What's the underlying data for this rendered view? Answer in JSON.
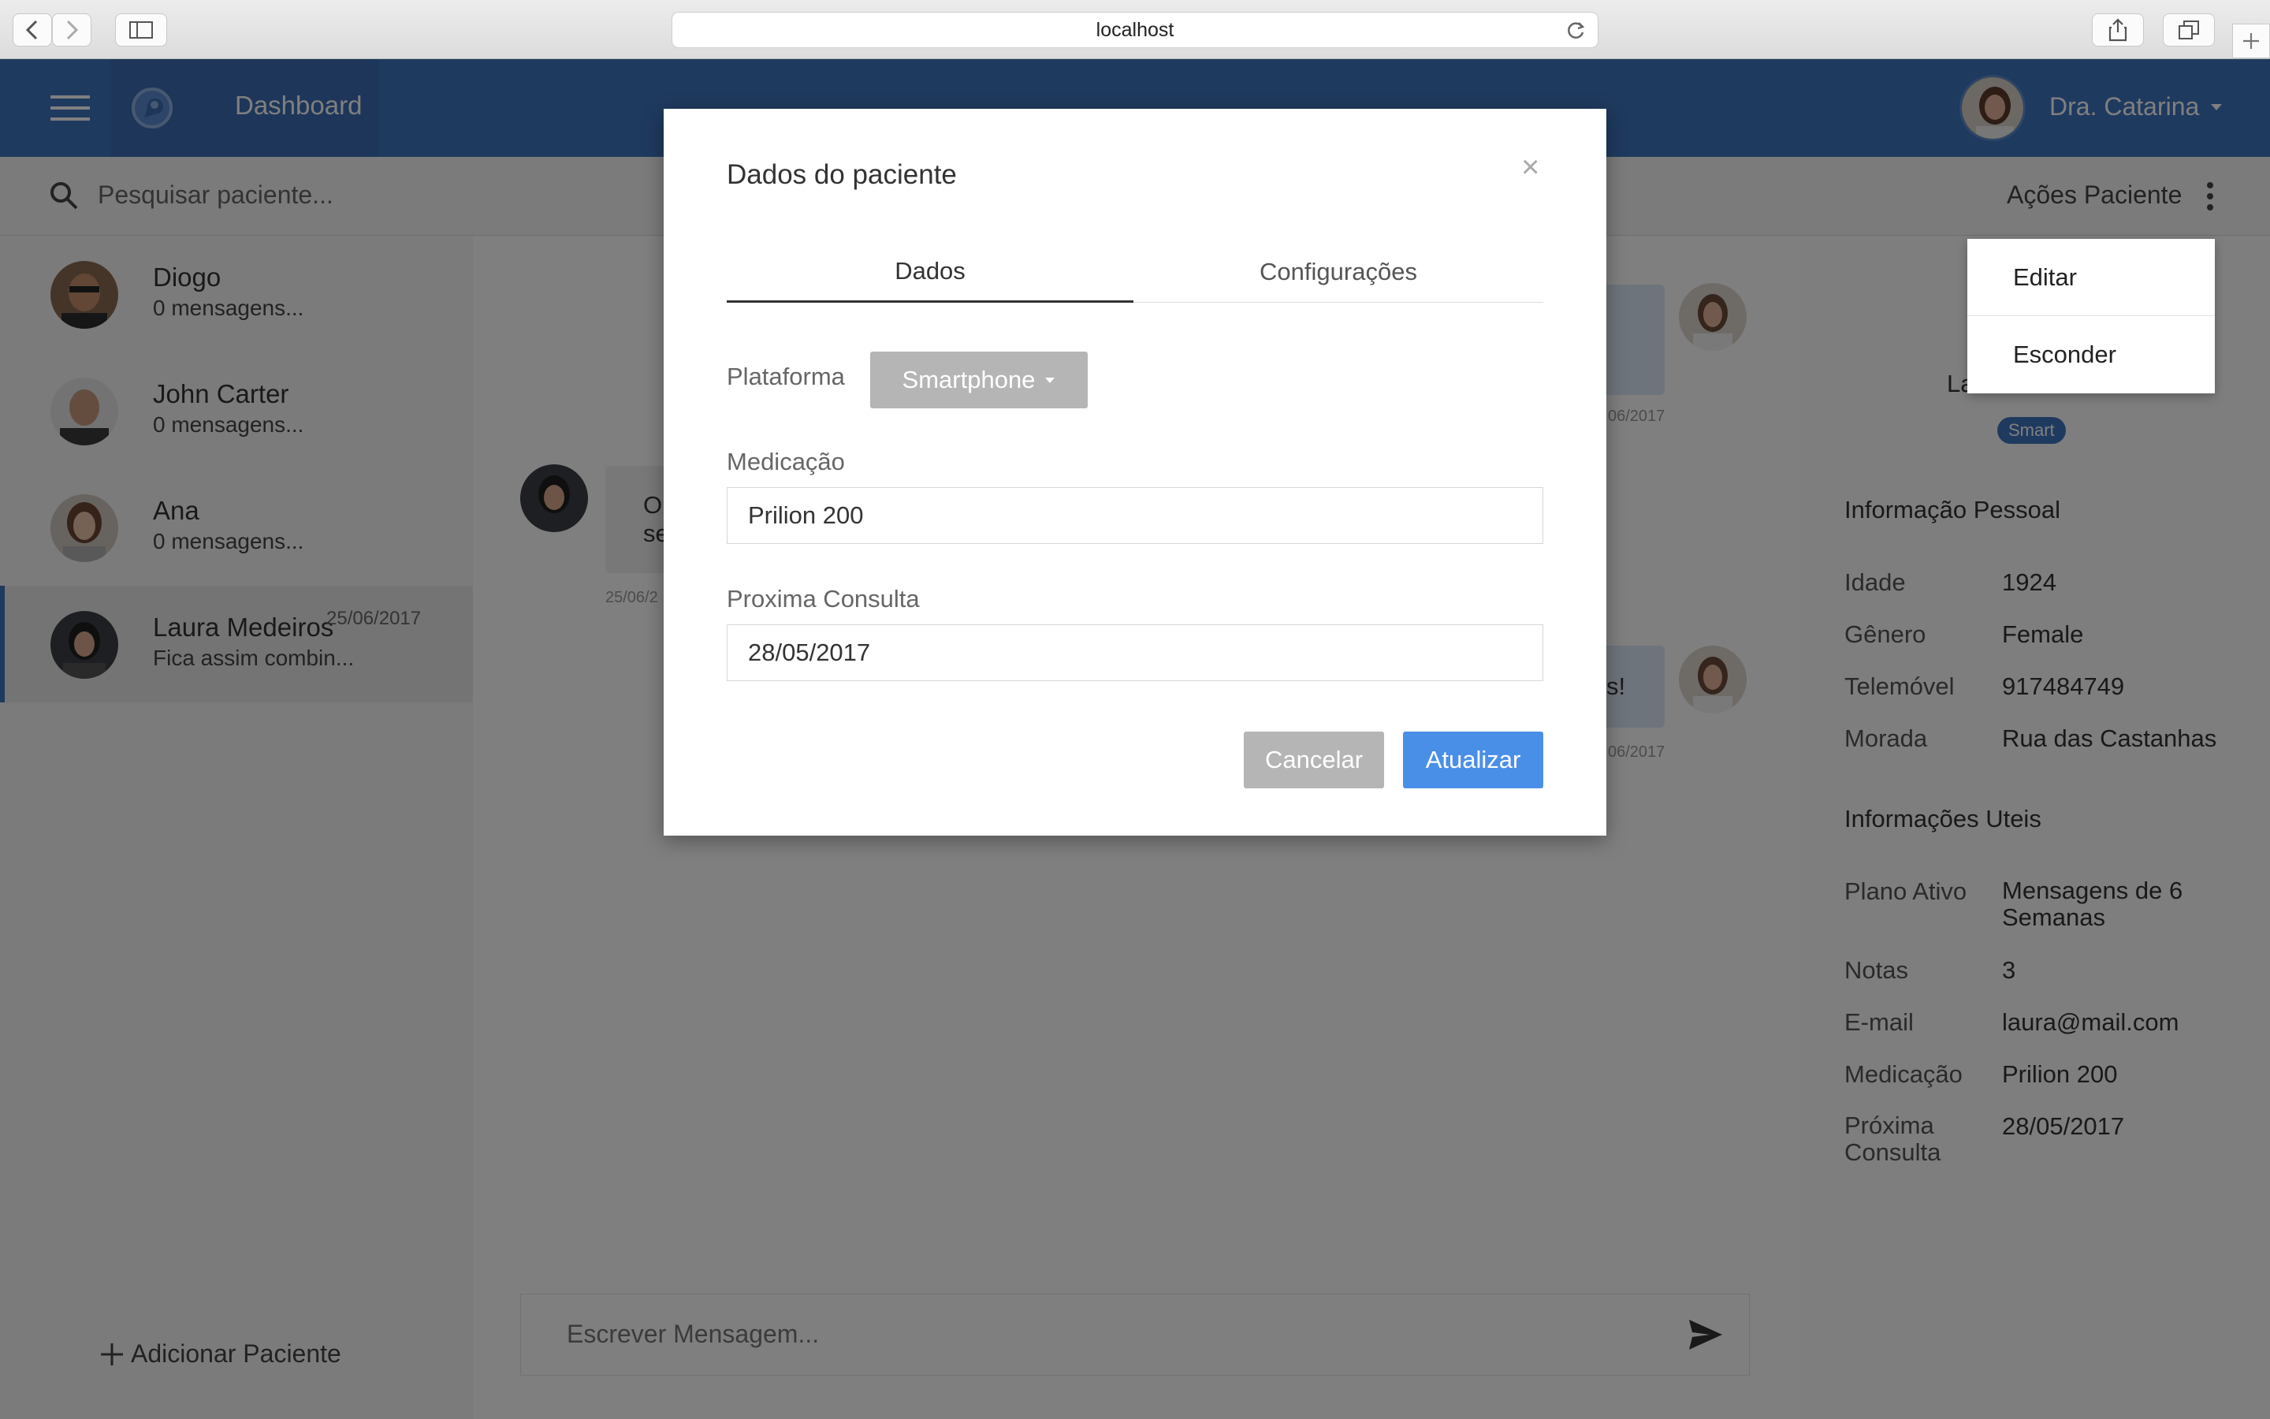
{
  "browser": {
    "url": "localhost"
  },
  "header": {
    "title": "Dashboard",
    "doctor_name": "Dra. Catarina"
  },
  "search": {
    "placeholder": "Pesquisar paciente...",
    "actions_label": "Ações Paciente"
  },
  "contacts": [
    {
      "name": "Diogo",
      "preview": "0 mensagens..."
    },
    {
      "name": "John Carter",
      "preview": "0 mensagens..."
    },
    {
      "name": "Ana",
      "preview": "0 mensagens..."
    },
    {
      "name": "Laura Medeiros",
      "preview": "Fica assim combin...",
      "date": "25/06/2017"
    }
  ],
  "add_patient_label": "Adicionar Paciente",
  "chat": {
    "message_placeholder": "Escrever Mensagem...",
    "fragments": {
      "left_line1": "Ol",
      "left_line2": "se",
      "left_date": "25/06/2",
      "right_date1": "06/2017",
      "right_text": "s!",
      "right_date2": "06/2017"
    }
  },
  "patient_panel": {
    "name_fragment": "La",
    "badge": "Smart",
    "personal_title": "Informação Pessoal",
    "personal": [
      {
        "k": "Idade",
        "v": "1924"
      },
      {
        "k": "Gênero",
        "v": "Female"
      },
      {
        "k": "Telemóvel",
        "v": "917484749"
      },
      {
        "k": "Morada",
        "v": "Rua das Castanhas"
      }
    ],
    "useful_title": "Informações Uteis",
    "useful": [
      {
        "k": "Plano Ativo",
        "v": "Mensagens de 6 Semanas"
      },
      {
        "k": "Notas",
        "v": "3"
      },
      {
        "k": "E-mail",
        "v": "laura@mail.com"
      },
      {
        "k": "Medicação",
        "v": "Prilion 200"
      },
      {
        "k": "Próxima Consulta",
        "v": "28/05/2017"
      }
    ]
  },
  "actions_menu": {
    "items": [
      "Editar",
      "Esconder"
    ]
  },
  "modal": {
    "title": "Dados do paciente",
    "close": "×",
    "tabs": [
      "Dados",
      "Configurações"
    ],
    "platform_label": "Plataforma",
    "platform_value": "Smartphone",
    "medication_label": "Medicação",
    "medication_value": "Prilion 200",
    "appointment_label": "Proxima Consulta",
    "appointment_value": "28/05/2017",
    "cancel": "Cancelar",
    "update": "Atualizar"
  },
  "colors": {
    "primary": "#3e74bf",
    "button_blue": "#4a8fe7",
    "button_grey": "#9e9e9e"
  }
}
